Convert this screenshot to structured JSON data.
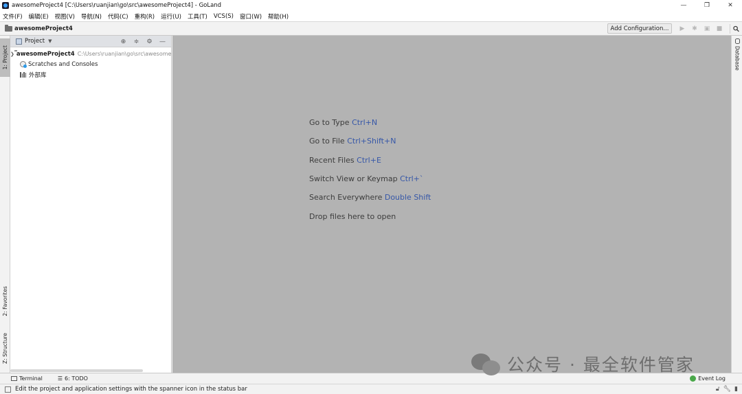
{
  "window": {
    "title": "awesomeProject4 [C:\\Users\\ruanjian\\go\\src\\awesomeProject4] - GoLand",
    "minimize_icon": "—",
    "maximize_icon": "❐",
    "close_icon": "✕"
  },
  "menu": [
    "文件(F)",
    "编辑(E)",
    "视图(V)",
    "导航(N)",
    "代码(C)",
    "重构(R)",
    "运行(U)",
    "工具(T)",
    "VCS(S)",
    "窗口(W)",
    "帮助(H)"
  ],
  "navbar": {
    "project": "awesomeProject4",
    "add_configuration": "Add Configuration..."
  },
  "left_strip": {
    "project_tab": "1: Project",
    "favorites_tab": "2: Favorites",
    "structure_tab": "Z: Structure"
  },
  "project_panel": {
    "title": "Project",
    "tree": {
      "root_name": "awesomeProject4",
      "root_path": "C:\\Users\\ruanjian\\go\\src\\awesomeProject4",
      "scratches": "Scratches and Consoles",
      "external_libs": "外部库"
    }
  },
  "editor_hints": [
    {
      "text": "Go to Type",
      "key": "Ctrl+N"
    },
    {
      "text": "Go to File",
      "key": "Ctrl+Shift+N"
    },
    {
      "text": "Recent Files",
      "key": "Ctrl+E"
    },
    {
      "text": "Switch View or Keymap",
      "key": "Ctrl+`"
    },
    {
      "text": "Search Everywhere",
      "key": "Double Shift"
    },
    {
      "text": "Drop files here to open",
      "key": ""
    }
  ],
  "right_strip": {
    "database_tab": "Database"
  },
  "bottom_tools": {
    "terminal": "Terminal",
    "todo": "6: TODO",
    "event_log": "Event Log"
  },
  "status": {
    "message": "Edit the project and application settings with the spanner icon in the status bar"
  },
  "watermark": {
    "text": "公众号 · 最全软件管家"
  }
}
